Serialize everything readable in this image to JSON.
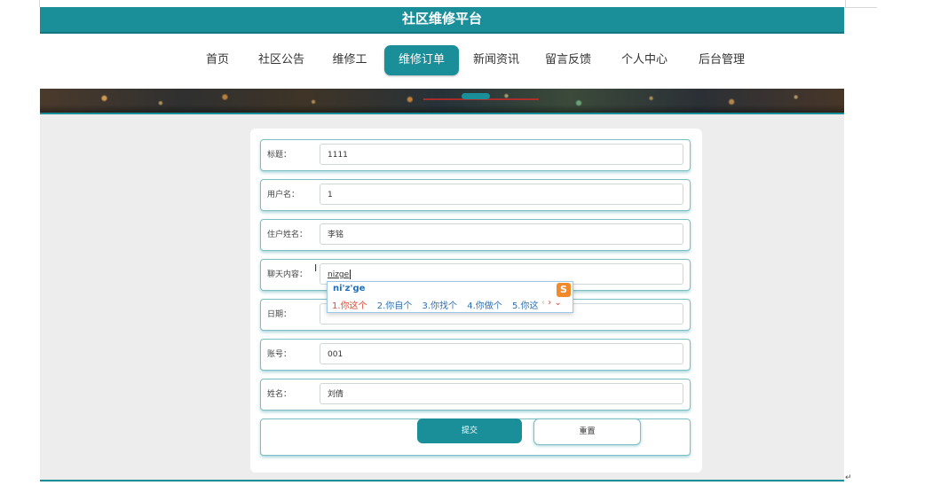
{
  "site": {
    "title": "社区维修平台"
  },
  "nav": {
    "items": [
      {
        "label": "首页"
      },
      {
        "label": "社区公告"
      },
      {
        "label": "维修工"
      },
      {
        "label": "维修订单",
        "active": true
      },
      {
        "label": "新闻资讯"
      },
      {
        "label": "留言反馈"
      },
      {
        "label": "个人中心"
      },
      {
        "label": "后台管理"
      }
    ]
  },
  "form": {
    "fields": [
      {
        "label": "标题：",
        "value": "1111"
      },
      {
        "label": "用户名：",
        "value": "1"
      },
      {
        "label": "住户姓名：",
        "value": "李铭"
      },
      {
        "label": "聊天内容：",
        "value": "nizge"
      },
      {
        "label": "日期：",
        "value": ""
      },
      {
        "label": "账号：",
        "value": "001"
      },
      {
        "label": "姓名：",
        "value": "刘倩"
      }
    ],
    "submit_label": "提交",
    "reset_label": "重置"
  },
  "ime": {
    "composition": "ni'z'ge",
    "candidates": [
      "1.你这个",
      "2.你自个",
      "3.你找个",
      "4.你做个",
      "5.你这"
    ],
    "logo": "S"
  },
  "colors": {
    "accent": "#1a8f9a",
    "ime_highlight": "#e3452e"
  }
}
